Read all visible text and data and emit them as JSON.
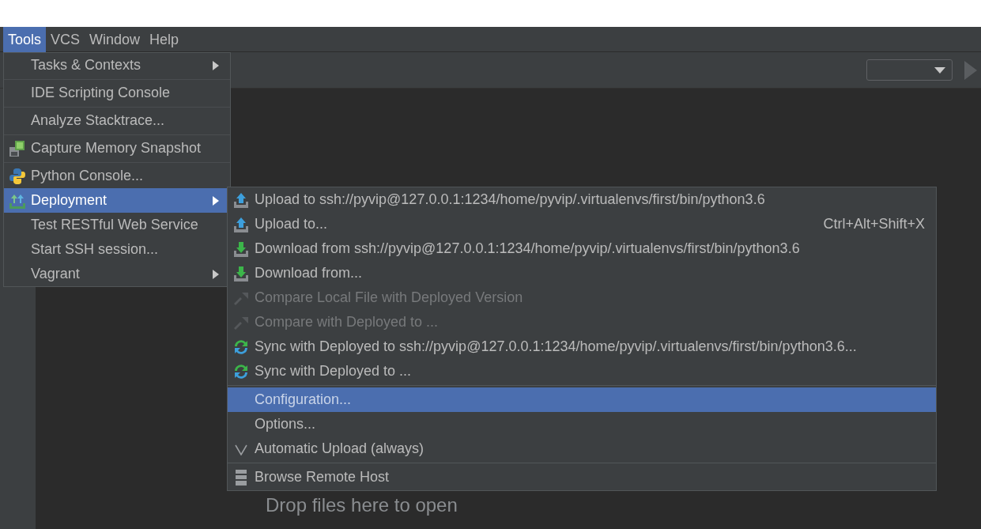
{
  "menu_bar": [
    {
      "label": "Tools",
      "selected": true
    },
    {
      "label": "VCS",
      "selected": false
    },
    {
      "label": "Window",
      "selected": false
    },
    {
      "label": "Help",
      "selected": false
    }
  ],
  "tools_menu": [
    {
      "kind": "plain",
      "label": "Tasks & Contexts",
      "submenu": true,
      "selected": false
    },
    {
      "kind": "separator"
    },
    {
      "kind": "plain",
      "label": "IDE Scripting Console",
      "submenu": false,
      "selected": false
    },
    {
      "kind": "separator"
    },
    {
      "kind": "plain",
      "label": "Analyze Stacktrace...",
      "submenu": false,
      "selected": false
    },
    {
      "kind": "separator"
    },
    {
      "kind": "memory",
      "label": "Capture Memory Snapshot",
      "submenu": false,
      "selected": false
    },
    {
      "kind": "separator"
    },
    {
      "kind": "python",
      "label": "Python Console...",
      "submenu": false,
      "selected": false
    },
    {
      "kind": "deploy",
      "label": "Deployment",
      "submenu": true,
      "selected": true
    },
    {
      "kind": "plain",
      "label": "Test RESTful Web Service",
      "submenu": false,
      "selected": false
    },
    {
      "kind": "plain",
      "label": "Start SSH session...",
      "submenu": false,
      "selected": false
    },
    {
      "kind": "plain",
      "label": "Vagrant",
      "submenu": true,
      "selected": false
    }
  ],
  "deployment_menu": [
    {
      "kind": "upload",
      "label": "Upload to ssh://pyvip@127.0.0.1:1234/home/pyvip/.virtualenvs/first/bin/python3.6",
      "disabled": false,
      "selected": false
    },
    {
      "kind": "upload",
      "label": "Upload to...",
      "shortcut": "Ctrl+Alt+Shift+X",
      "disabled": false,
      "selected": false
    },
    {
      "kind": "download",
      "label": "Download from ssh://pyvip@127.0.0.1:1234/home/pyvip/.virtualenvs/first/bin/python3.6",
      "disabled": false,
      "selected": false
    },
    {
      "kind": "download",
      "label": "Download from...",
      "disabled": false,
      "selected": false
    },
    {
      "kind": "compare",
      "label": "Compare Local File with Deployed Version",
      "disabled": true,
      "selected": false
    },
    {
      "kind": "compare",
      "label": "Compare with Deployed to ...",
      "disabled": true,
      "selected": false
    },
    {
      "kind": "sync",
      "label": "Sync with Deployed to ssh://pyvip@127.0.0.1:1234/home/pyvip/.virtualenvs/first/bin/python3.6...",
      "disabled": false,
      "selected": false
    },
    {
      "kind": "sync",
      "label": "Sync with Deployed to ...",
      "disabled": false,
      "selected": false
    },
    {
      "kind": "separator"
    },
    {
      "kind": "plain",
      "label": "Configuration...",
      "disabled": false,
      "selected": true
    },
    {
      "kind": "plain",
      "label": "Options...",
      "disabled": false,
      "selected": false
    },
    {
      "kind": "check",
      "label": "Automatic Upload (always)",
      "checked": true,
      "disabled": false,
      "selected": false
    },
    {
      "kind": "separator"
    },
    {
      "kind": "server",
      "label": "Browse Remote Host",
      "disabled": false,
      "selected": false
    }
  ],
  "editor": {
    "empty_hint": "Drop files here to open"
  }
}
